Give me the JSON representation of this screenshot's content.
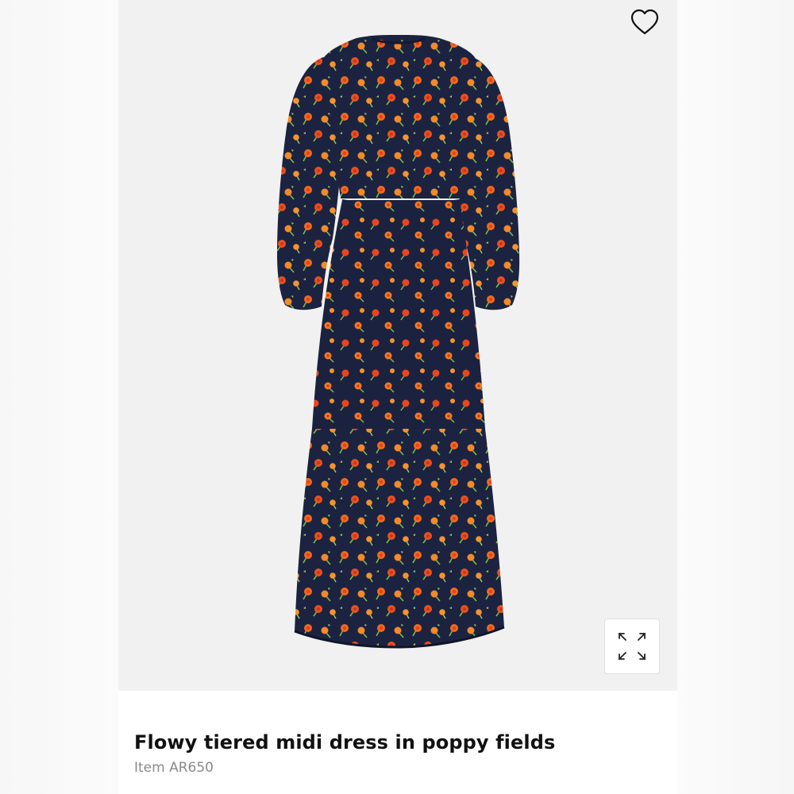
{
  "product": {
    "title": "Flowy tiered midi dress in poppy fields",
    "item_number": "Item AR650",
    "image_alt": "Navy midi dress with orange poppy print"
  },
  "icons": {
    "favorite": "heart-outline-icon",
    "expand": "expand-arrows-icon"
  },
  "colors": {
    "dress_navy": "#1c2340",
    "poppy_orange": "#f06a1c",
    "poppy_red": "#e2401f",
    "leaf_green": "#7fb84a",
    "background": "#f1f1f1"
  }
}
